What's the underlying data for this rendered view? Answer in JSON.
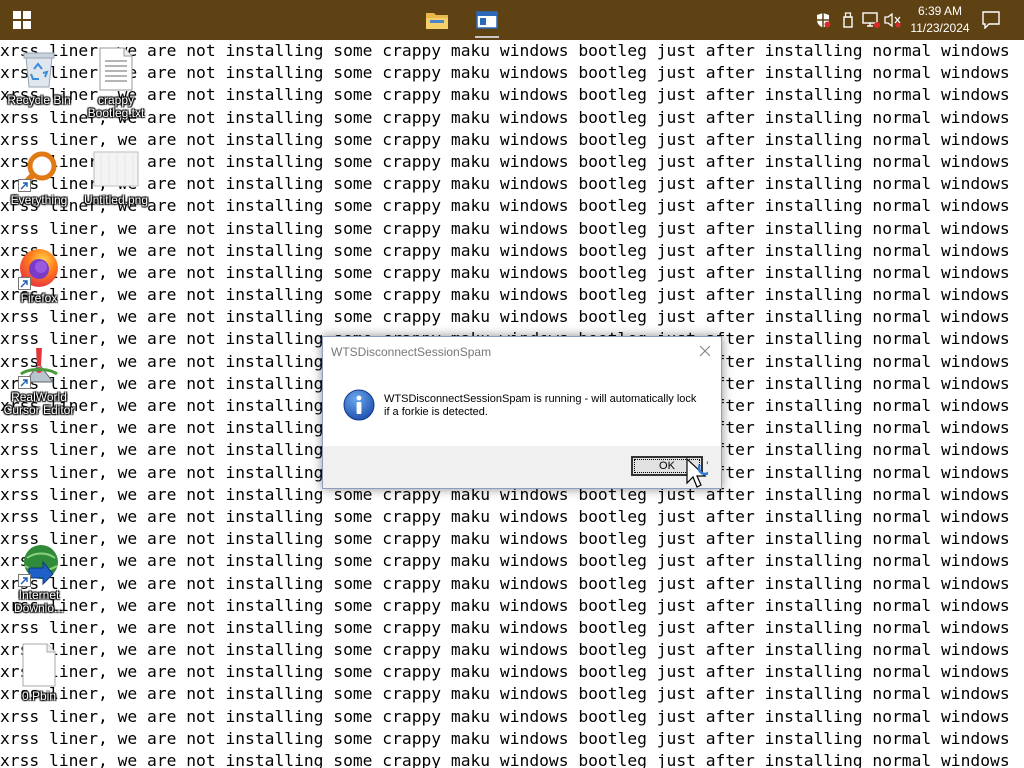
{
  "taskbar": {
    "start_icon": "windows-logo-icon",
    "apps": [
      {
        "name": "file-explorer",
        "icon": "folder-icon"
      },
      {
        "name": "active-window",
        "icon": "window-icon"
      }
    ],
    "tray_icons": [
      "security-shield-icon",
      "usb-drive-icon",
      "network-icon",
      "volume-muted-icon"
    ],
    "clock": {
      "time": "6:39 AM",
      "date": "11/23/2024"
    },
    "notification_icon": "action-center-icon",
    "color": "#5e4214"
  },
  "background_text": {
    "line": "xrss liner, we are not installing some crappy maku windows bootleg just after installing normal windows",
    "line_count": 33
  },
  "desktop": {
    "icons": [
      {
        "label": "Recycle Bin",
        "icon": "recycle-bin-icon"
      },
      {
        "label": "crappy\nBootleg.txt",
        "icon": "text-file-icon"
      },
      {
        "label": "Everything",
        "icon": "everything-search-icon"
      },
      {
        "label": "Untitled.png",
        "icon": "image-file-icon"
      },
      {
        "label": "Firefox",
        "icon": "firefox-icon"
      },
      {
        "label": "RealWorld\nCursor Editor",
        "icon": "cursor-editor-icon"
      },
      {
        "label": "Internet\nDownlo...",
        "icon": "internet-download-manager-icon"
      },
      {
        "label": "0.Pbin",
        "icon": "blank-file-icon"
      }
    ]
  },
  "dialog": {
    "title": "WTSDisconnectSessionSpam",
    "message": "WTSDisconnectSessionSpam is running - will automatically lock if a forkie is detected.",
    "ok_label": "OK",
    "icon": "information-icon"
  }
}
